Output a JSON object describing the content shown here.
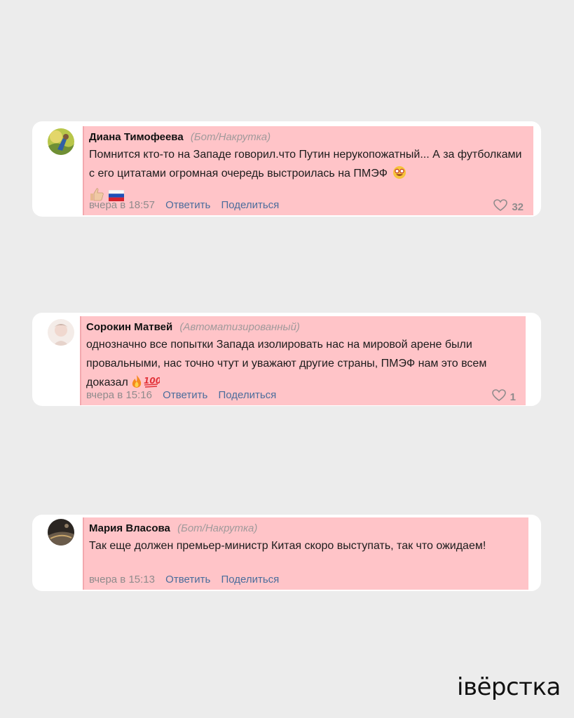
{
  "comments": [
    {
      "author": "Диана Тимофеева",
      "tag": "(Бот/Накрутка)",
      "text": "Помнится кто-то на Западе говорил.что Путин нерукопожатный... А за футболками с его цитатами огромная очередь выстроилась на ПМЭФ",
      "emoji": [
        "star-struck-icon",
        "thumbs-up-icon",
        "russian-flag-icon"
      ],
      "time": "вчера в 18:57",
      "reply_label": "Ответить",
      "share_label": "Поделиться",
      "likes": "32"
    },
    {
      "author": "Сорокин Матвей",
      "tag": "(Автоматизированный)",
      "text": "однозначно все попытки Запада изолировать нас на мировой арене были провальными, нас точно чтут и уважают другие страны, ПМЭФ нам это всем доказал",
      "emoji": [
        "fire-icon",
        "hundred-points-icon"
      ],
      "time": "вчера в 15:16",
      "reply_label": "Ответить",
      "share_label": "Поделиться",
      "likes": "1"
    },
    {
      "author": "Мария Власова",
      "tag": "(Бот/Накрутка)",
      "text": "Так еще должен премьер-министр Китая скоро выступать, так что ожидаем!",
      "time": "вчера в 15:13",
      "reply_label": "Ответить",
      "share_label": "Поделиться"
    }
  ],
  "logo": "iвёрстка",
  "colors": {
    "highlight": "#ffc4c8",
    "link": "#4a6d9c",
    "background": "#ececec"
  }
}
